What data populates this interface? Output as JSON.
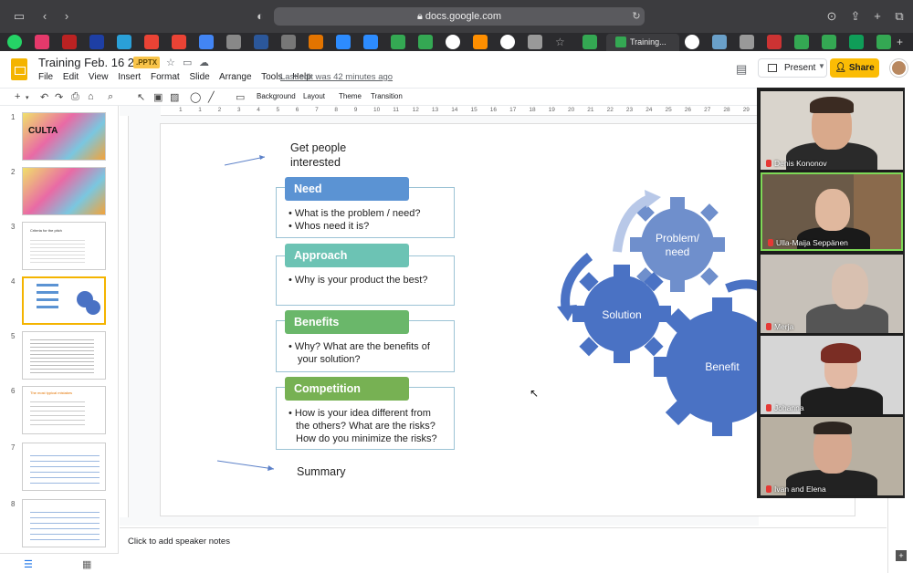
{
  "browser": {
    "url": "docs.google.com",
    "active_tab_title": "Training..."
  },
  "doc": {
    "title": "Training Feb. 16 2021",
    "format_badge": ".PPTX",
    "menu": [
      "File",
      "Edit",
      "View",
      "Insert",
      "Format",
      "Slide",
      "Arrange",
      "Tools",
      "Help"
    ],
    "last_edit": "Last edit was 42 minutes ago",
    "present_label": "Present",
    "share_label": "Share"
  },
  "toolbar": {
    "background": "Background",
    "layout": "Layout",
    "theme": "Theme",
    "transition": "Transition",
    "ruler_ticks": [
      "1",
      "1",
      "2",
      "3",
      "4",
      "5",
      "6",
      "7",
      "8",
      "9",
      "10",
      "11",
      "12",
      "13",
      "14",
      "15",
      "16",
      "17",
      "18",
      "19",
      "20",
      "21",
      "22",
      "23",
      "24",
      "25",
      "26",
      "27",
      "28",
      "29"
    ]
  },
  "filmstrip": {
    "numbers": [
      "1",
      "2",
      "3",
      "4",
      "5",
      "6",
      "7",
      "8"
    ],
    "slide1_title": "CULTA",
    "slide3_title": "Criteria for the pitch",
    "slide6_title": "The most typical mistakes"
  },
  "slide": {
    "top_label": "Get people interested",
    "bottom_label": "Summary",
    "sections": [
      {
        "title": "Need",
        "bullets": [
          "What is the problem / need?",
          "Whos need it is?"
        ]
      },
      {
        "title": "Approach",
        "bullets": [
          "Why is your product the best?"
        ]
      },
      {
        "title": "Benefits",
        "bullets": [
          "Why? What are the benefits of your solution?"
        ]
      },
      {
        "title": "Competition",
        "bullets": [
          "How is your idea different from the others? What are the risks? How do you minimize the risks?"
        ]
      }
    ],
    "gears": {
      "problem": "Problem/ need",
      "solution": "Solution",
      "benefit": "Benefit"
    }
  },
  "notes_placeholder": "Click to add speaker notes",
  "participants": [
    "Denis Kononov",
    "Ulla-Maija Seppänen",
    "Merja",
    "Johanna",
    "Ivan and Elena"
  ],
  "colors": {
    "need": "#5b93d3",
    "approach": "#6cc3b4",
    "benefits": "#6ab76a",
    "competition": "#77b153",
    "gear": "#4a72c4",
    "share": "#fbbc04"
  }
}
